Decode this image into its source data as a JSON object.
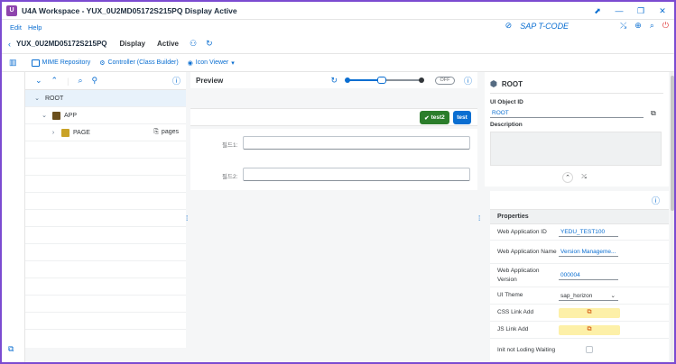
{
  "window": {
    "title": "U4A Workspace - YUX_0U2MD05172S215PQ Display Active",
    "logo": "U4A",
    "controls": [
      "pin-icon",
      "minimize-icon",
      "maximize-icon",
      "close-icon"
    ]
  },
  "menu": {
    "items": [
      "Edit",
      "Help"
    ]
  },
  "topright": {
    "tcode_label": "SAP T-CODE"
  },
  "header": {
    "app_id": "YUX_0U2MD05172S215PQ",
    "mode": "Display",
    "status": "Active"
  },
  "toolbar": {
    "mime": "MIME Repository",
    "controller": "Controller (Class Builder)",
    "icon_viewer": "Icon Viewer"
  },
  "tree": {
    "nodes": [
      {
        "label": "ROOT",
        "level": 0
      },
      {
        "label": "APP",
        "level": 1
      },
      {
        "label": "PAGE",
        "level": 2,
        "aggregation": "pages"
      }
    ]
  },
  "preview": {
    "title": "Preview",
    "toggle": "OFF",
    "buttons": {
      "green": "test2",
      "blue": "test"
    },
    "fields": [
      {
        "label": "필드1:"
      },
      {
        "label": "필드2:"
      }
    ]
  },
  "attributes": {
    "title": "ROOT",
    "ui_object_id_label": "UI Object ID",
    "ui_object_id_value": "ROOT",
    "description_label": "Description"
  },
  "properties": {
    "title": "Properties",
    "rows": [
      {
        "key": "Web Application ID",
        "value": "YEDU_TEST100"
      },
      {
        "key": "Web Application Name",
        "value": "Version Manageme..."
      },
      {
        "key": "Web Application Version",
        "value": "000004"
      },
      {
        "key": "UI Theme",
        "value": "sap_horizon"
      },
      {
        "key": "CSS Link Add",
        "value": "⧉"
      },
      {
        "key": "JS Link Add",
        "value": "⧉"
      },
      {
        "key": "Init not Loding Waiting",
        "value": ""
      }
    ]
  },
  "colors": {
    "accent": "#0a6ed1",
    "frame": "#7b4bd1",
    "green": "#2b7d2b",
    "yellow": "#fdf0a8"
  }
}
